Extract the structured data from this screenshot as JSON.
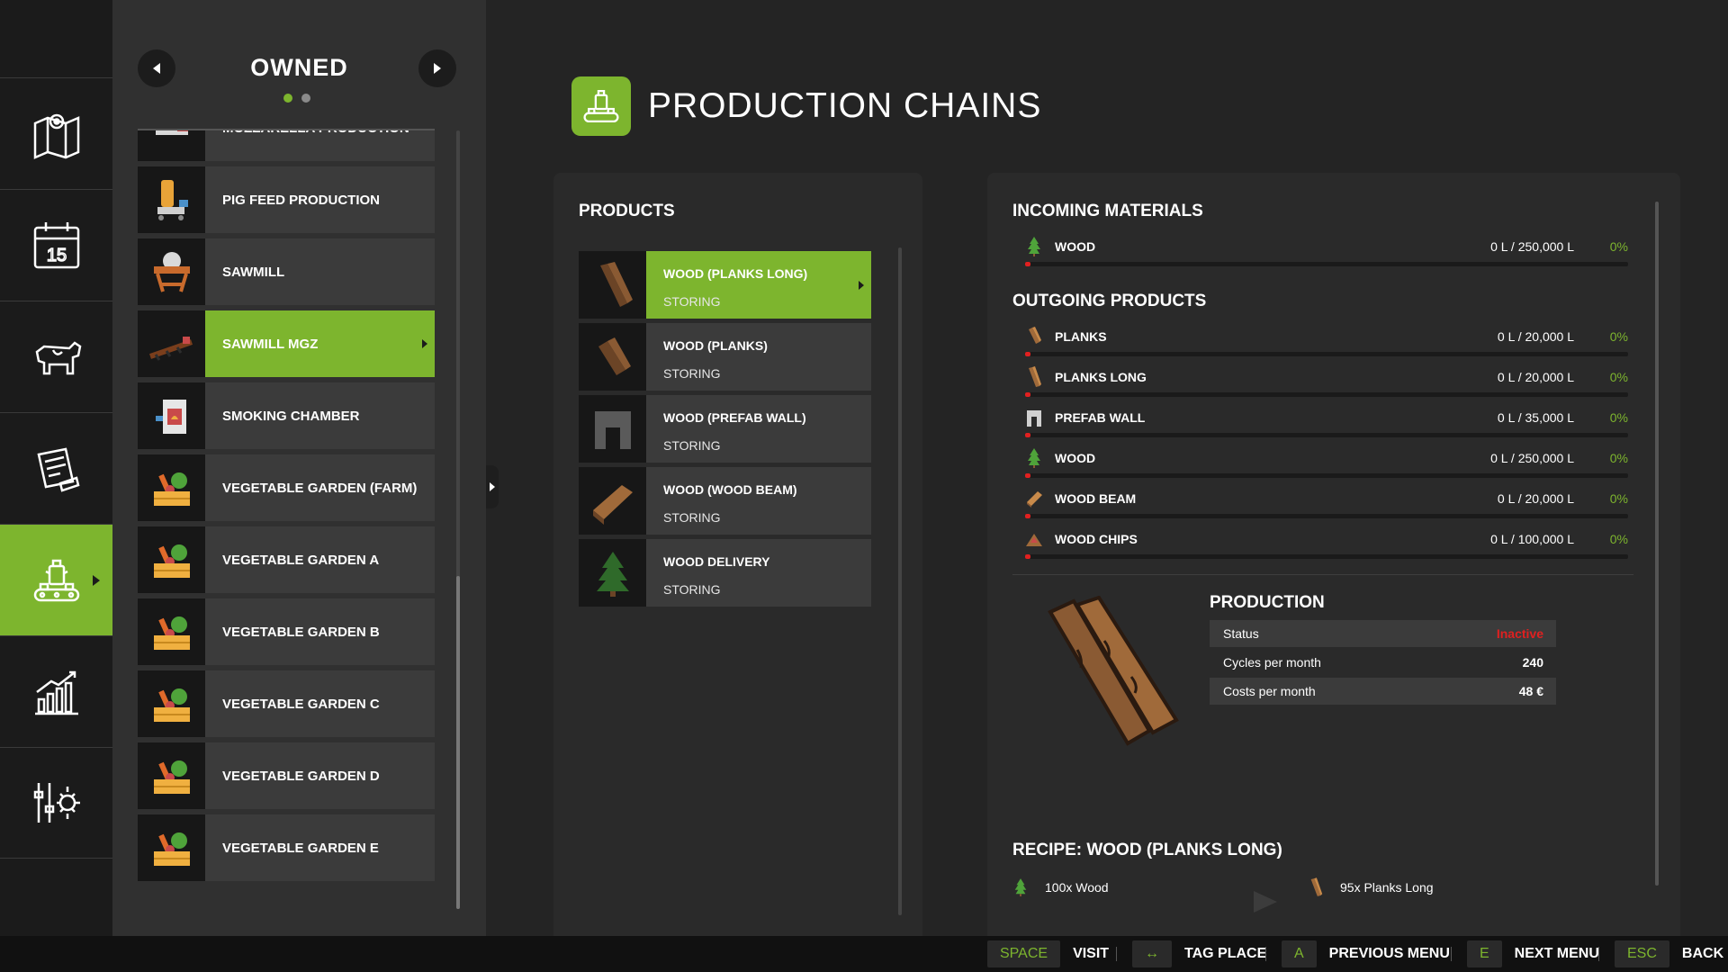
{
  "owned": {
    "title": "OWNED",
    "page_dots": 2,
    "active_dot": 0,
    "items": [
      {
        "label": "MOZZARELLA PRODUCTION",
        "icon": "mozzarella-icon"
      },
      {
        "label": "PIG FEED PRODUCTION",
        "icon": "pig-feed-icon"
      },
      {
        "label": "SAWMILL",
        "icon": "sawmill-icon"
      },
      {
        "label": "SAWMILL MGZ",
        "icon": "sawmill-mgz-icon",
        "active": true
      },
      {
        "label": "SMOKING CHAMBER",
        "icon": "smoking-chamber-icon"
      },
      {
        "label": "VEGETABLE GARDEN (FARM)",
        "icon": "vegetable-crate-icon"
      },
      {
        "label": "VEGETABLE GARDEN A",
        "icon": "vegetable-crate-icon"
      },
      {
        "label": "VEGETABLE GARDEN B",
        "icon": "vegetable-crate-icon"
      },
      {
        "label": "VEGETABLE GARDEN C",
        "icon": "vegetable-crate-icon"
      },
      {
        "label": "VEGETABLE GARDEN D",
        "icon": "vegetable-crate-icon"
      },
      {
        "label": "VEGETABLE GARDEN E",
        "icon": "vegetable-crate-icon"
      }
    ]
  },
  "nav": [
    {
      "icon": "map-icon"
    },
    {
      "icon": "calendar-icon",
      "text": "15"
    },
    {
      "icon": "cow-icon"
    },
    {
      "icon": "contracts-icon"
    },
    {
      "icon": "production-icon",
      "active": true
    },
    {
      "icon": "statistics-icon"
    },
    {
      "icon": "settings-icon"
    }
  ],
  "header": {
    "title": "PRODUCTION CHAINS",
    "icon": "production-icon"
  },
  "products": {
    "title": "PRODUCTS",
    "items": [
      {
        "name": "WOOD (PLANKS LONG)",
        "status": "STORING",
        "icon": "planks-long-icon",
        "active": true
      },
      {
        "name": "WOOD (PLANKS)",
        "status": "STORING",
        "icon": "planks-icon"
      },
      {
        "name": "WOOD (PREFAB WALL)",
        "status": "STORING",
        "icon": "prefab-wall-icon"
      },
      {
        "name": "WOOD (WOOD BEAM)",
        "status": "STORING",
        "icon": "wood-beam-icon"
      },
      {
        "name": "WOOD DELIVERY",
        "status": "STORING",
        "icon": "tree-icon"
      }
    ]
  },
  "incoming": {
    "title": "INCOMING MATERIALS",
    "items": [
      {
        "name": "WOOD",
        "amount": "0 L / 250,000 L",
        "percent": "0%",
        "icon": "tree-icon"
      }
    ]
  },
  "outgoing": {
    "title": "OUTGOING PRODUCTS",
    "items": [
      {
        "name": "PLANKS",
        "amount": "0 L / 20,000 L",
        "percent": "0%",
        "icon": "planks-icon"
      },
      {
        "name": "PLANKS LONG",
        "amount": "0 L / 20,000 L",
        "percent": "0%",
        "icon": "planks-long-icon"
      },
      {
        "name": "PREFAB WALL",
        "amount": "0 L / 35,000 L",
        "percent": "0%",
        "icon": "prefab-wall-icon"
      },
      {
        "name": "WOOD",
        "amount": "0 L / 250,000 L",
        "percent": "0%",
        "icon": "tree-icon"
      },
      {
        "name": "WOOD BEAM",
        "amount": "0 L / 20,000 L",
        "percent": "0%",
        "icon": "wood-beam-icon"
      },
      {
        "name": "WOOD CHIPS",
        "amount": "0 L / 100,000 L",
        "percent": "0%",
        "icon": "wood-chips-icon"
      }
    ]
  },
  "production": {
    "title": "PRODUCTION",
    "image": "planks-long-icon",
    "rows": [
      {
        "key": "Status",
        "value": "Inactive"
      },
      {
        "key": "Cycles per month",
        "value": "240"
      },
      {
        "key": "Costs per month",
        "value": "48 €"
      }
    ]
  },
  "recipe": {
    "title": "RECIPE: WOOD (PLANKS LONG)",
    "input": {
      "text": "100x Wood",
      "icon": "tree-icon"
    },
    "output": {
      "text": "95x Planks Long",
      "icon": "planks-long-icon"
    }
  },
  "bottom_bar": [
    {
      "key": "SPACE",
      "label": "VISIT"
    },
    {
      "key": "↔",
      "label": "TAG PLACE"
    },
    {
      "key": "A",
      "label": "PREVIOUS MENU"
    },
    {
      "key": "E",
      "label": "NEXT MENU"
    },
    {
      "key": "ESC",
      "label": "BACK"
    }
  ],
  "colors": {
    "accent": "#7db52e",
    "inactive": "#e02020",
    "background": "#242424"
  }
}
